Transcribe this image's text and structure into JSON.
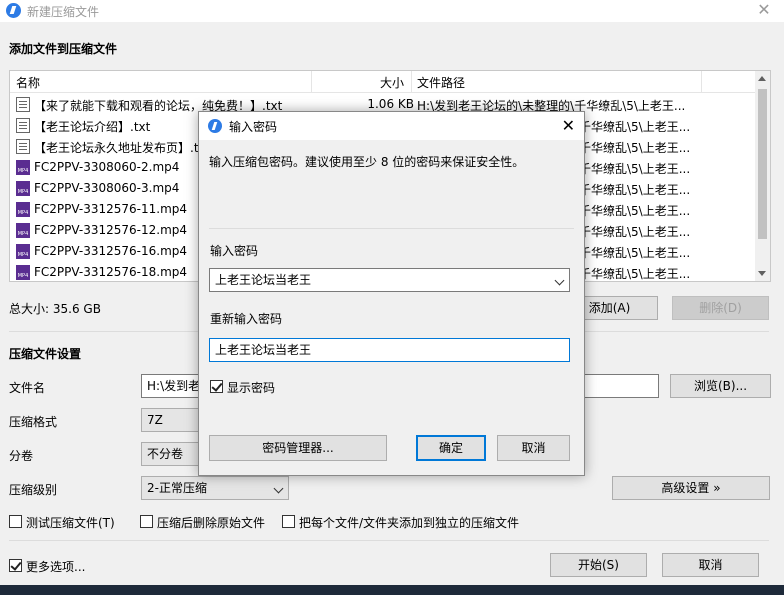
{
  "window": {
    "title": "新建压缩文件",
    "close": "✕"
  },
  "section_add": "添加文件到压缩文件",
  "columns": {
    "name": "名称",
    "size": "大小",
    "path": "文件路径"
  },
  "files": [
    {
      "name": "【来了就能下载和观看的论坛，纯免费！】.txt",
      "size": "1.06 KB",
      "path": "H:\\发到老王论坛的\\未整理的\\千华缭乱\\5\\上老王...",
      "type": "txt"
    },
    {
      "name": "【老王论坛介绍】.txt",
      "size": "",
      "path": "千华缭乱\\5\\上老王...",
      "type": "txt"
    },
    {
      "name": "【老王论坛永久地址发布页】.txt",
      "size": "",
      "path": "千华缭乱\\5\\上老王...",
      "type": "txt"
    },
    {
      "name": "FC2PPV-3308060-2.mp4",
      "size": "",
      "path": "千华缭乱\\5\\上老王...",
      "type": "mp4"
    },
    {
      "name": "FC2PPV-3308060-3.mp4",
      "size": "",
      "path": "千华缭乱\\5\\上老王...",
      "type": "mp4"
    },
    {
      "name": "FC2PPV-3312576-11.mp4",
      "size": "",
      "path": "千华缭乱\\5\\上老王...",
      "type": "mp4"
    },
    {
      "name": "FC2PPV-3312576-12.mp4",
      "size": "",
      "path": "千华缭乱\\5\\上老王...",
      "type": "mp4"
    },
    {
      "name": "FC2PPV-3312576-16.mp4",
      "size": "",
      "path": "千华缭乱\\5\\上老王...",
      "type": "mp4"
    },
    {
      "name": "FC2PPV-3312576-18.mp4",
      "size": "",
      "path": "千华缭乱\\5\\上老王...",
      "type": "mp4"
    }
  ],
  "total_size": "总大小: 35.6 GB",
  "add_button": "添加(A)",
  "delete_button": "删除(D)",
  "section_settings": "压缩文件设置",
  "settings": {
    "filename_label": "文件名",
    "filename_value": "H:\\发到老",
    "browse_button": "浏览(B)...",
    "format_label": "压缩格式",
    "format_value": "7Z",
    "split_label": "分卷",
    "split_value": "不分卷",
    "level_label": "压缩级别",
    "level_value": "2-正常压缩",
    "advanced_button": "高级设置 »"
  },
  "options": {
    "test": "测试压缩文件(T)",
    "delete_after": "压缩后删除原始文件",
    "separate": "把每个文件/文件夹添加到独立的压缩文件"
  },
  "more_options": "更多选项...",
  "start_button": "开始(S)",
  "cancel_button": "取消",
  "dialog": {
    "title": "输入密码",
    "close": "✕",
    "hint": "输入压缩包密码。建议使用至少 8 位的密码来保证安全性。",
    "enter_label": "输入密码",
    "enter_value": "上老王论坛当老王",
    "reenter_label": "重新输入密码",
    "reenter_value": "上老王论坛当老王",
    "show_password": "显示密码",
    "manager_button": "密码管理器...",
    "ok_button": "确定",
    "cancel_button": "取消"
  },
  "colors": {
    "accent": "#0078d7",
    "app_icon": "#2d7be5",
    "mp4_icon": "#5a2d91"
  }
}
